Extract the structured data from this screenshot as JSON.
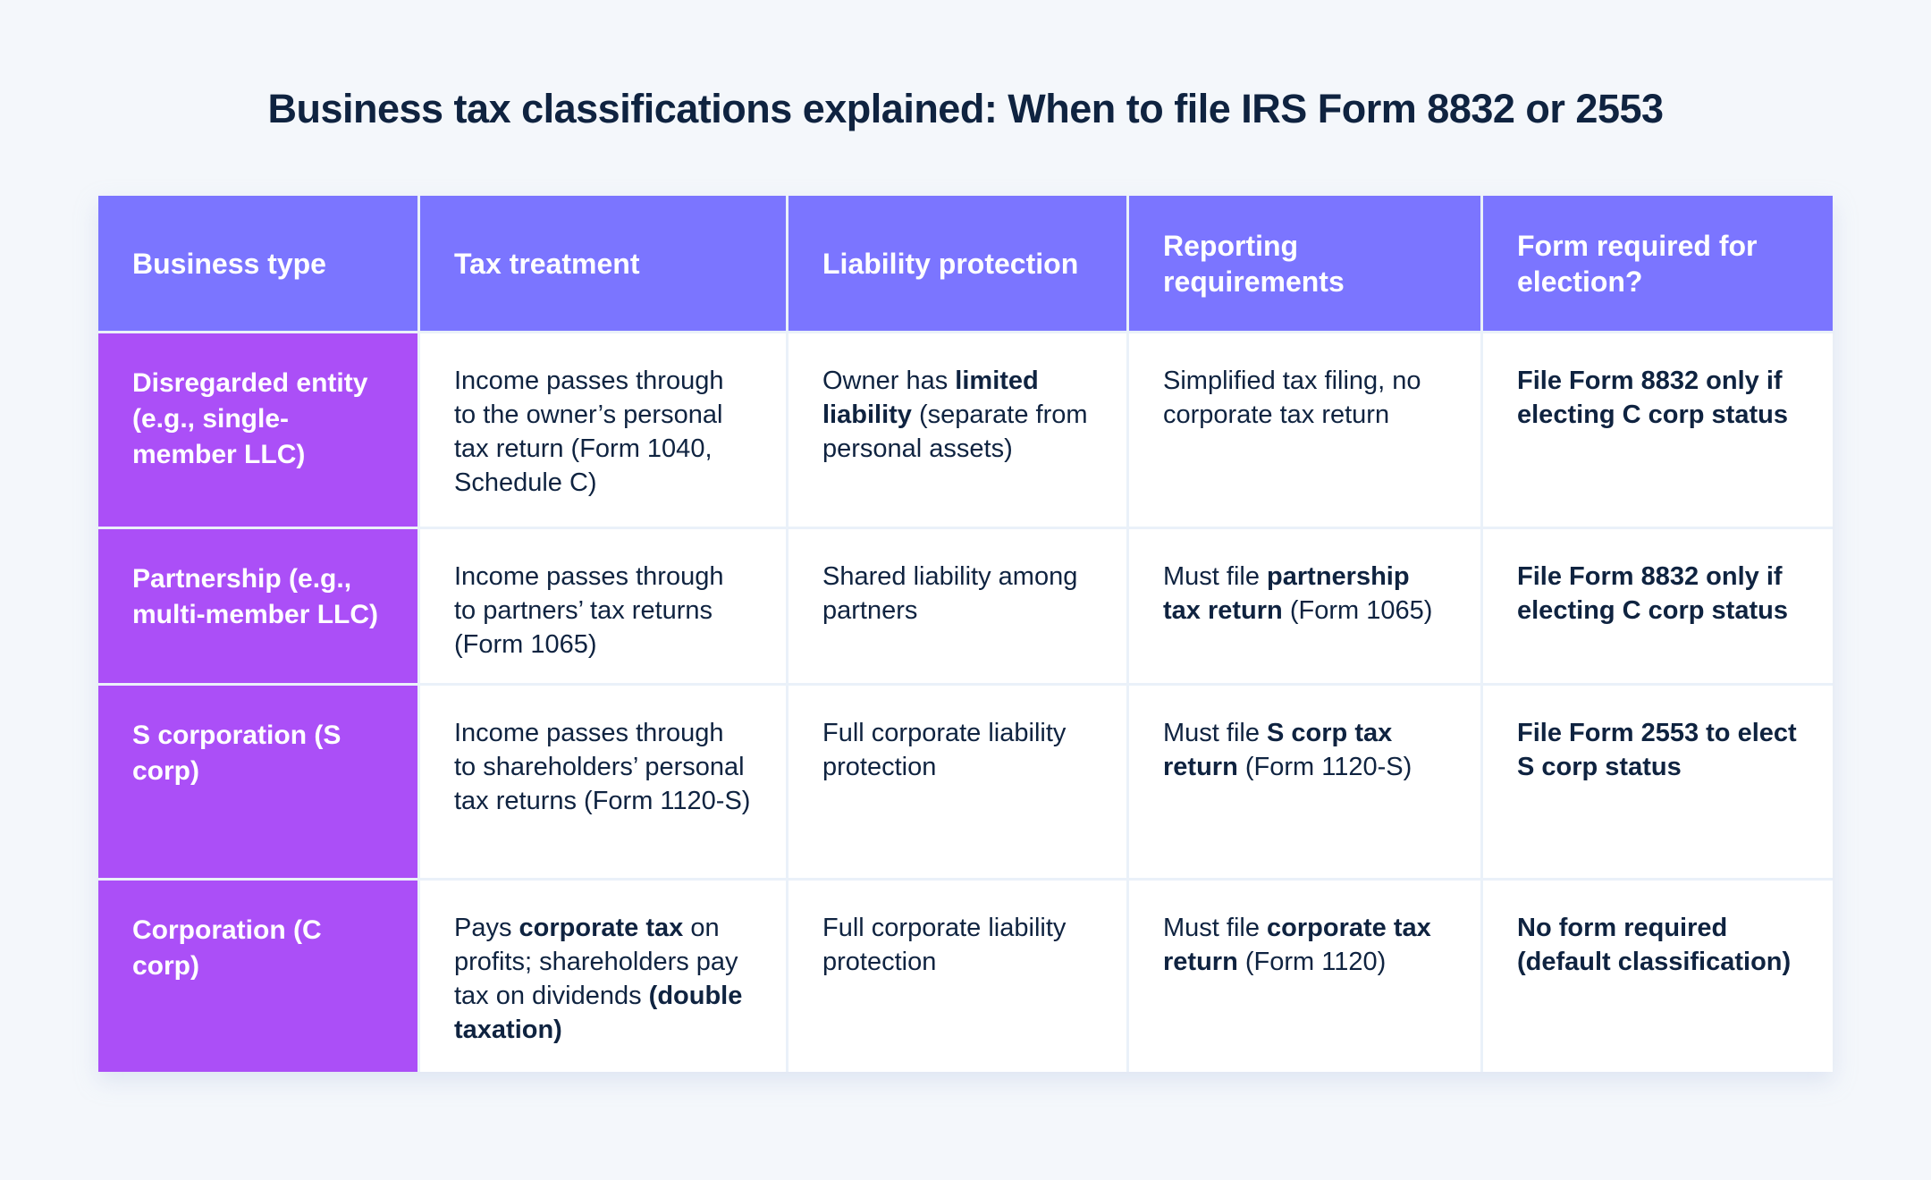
{
  "title": "Business tax classifications explained: When to file IRS Form 8832 or 2553",
  "colors": {
    "background": "#F4F7FB",
    "header": "#7B75FF",
    "type_column": "#AB4FF7",
    "text": "#0F2340"
  },
  "table": {
    "headers": [
      "Business type",
      "Tax treatment",
      "Liability protection",
      "Reporting requirements",
      "Form required for election?"
    ],
    "rows": [
      {
        "business_type": "Disregarded entity (e.g., single-member LLC)",
        "tax_treatment": [
          {
            "text": "Income passes through to the owner’s personal tax return (Form 1040, Schedule C)",
            "bold": false
          }
        ],
        "liability_protection": [
          {
            "text": "Owner has ",
            "bold": false
          },
          {
            "text": "limited liability",
            "bold": true
          },
          {
            "text": " (separate from personal assets)",
            "bold": false
          }
        ],
        "reporting_requirements": [
          {
            "text": "Simplified tax filing, no corporate tax return",
            "bold": false
          }
        ],
        "form_required": "File Form 8832 only if electing C corp status"
      },
      {
        "business_type": "Partnership (e.g., multi-member LLC)",
        "tax_treatment": [
          {
            "text": "Income passes through to partners’ tax returns (Form 1065)",
            "bold": false
          }
        ],
        "liability_protection": [
          {
            "text": "Shared liability among partners",
            "bold": false
          }
        ],
        "reporting_requirements": [
          {
            "text": "Must file ",
            "bold": false
          },
          {
            "text": "partnership tax return",
            "bold": true
          },
          {
            "text": " (Form 1065)",
            "bold": false
          }
        ],
        "form_required": "File Form 8832 only if electing C corp status"
      },
      {
        "business_type": "S corporation (S corp)",
        "tax_treatment": [
          {
            "text": "Income passes through to shareholders’ personal tax returns (Form 1120-S)",
            "bold": false
          }
        ],
        "liability_protection": [
          {
            "text": "Full corporate liability protection",
            "bold": false
          }
        ],
        "reporting_requirements": [
          {
            "text": "Must file ",
            "bold": false
          },
          {
            "text": "S corp tax return",
            "bold": true
          },
          {
            "text": " (Form 1120-S)",
            "bold": false
          }
        ],
        "form_required": "File Form 2553 to elect S corp status"
      },
      {
        "business_type": "Corporation (C corp)",
        "tax_treatment": [
          {
            "text": "Pays ",
            "bold": false
          },
          {
            "text": "corporate tax",
            "bold": true
          },
          {
            "text": " on profits; shareholders pay tax on dividends ",
            "bold": false
          },
          {
            "text": "(double taxation)",
            "bold": true
          }
        ],
        "liability_protection": [
          {
            "text": "Full corporate liability protection",
            "bold": false
          }
        ],
        "reporting_requirements": [
          {
            "text": "Must file ",
            "bold": false
          },
          {
            "text": "corporate tax return",
            "bold": true
          },
          {
            "text": " (Form 1120)",
            "bold": false
          }
        ],
        "form_required": "No form required (default classification)"
      }
    ]
  }
}
